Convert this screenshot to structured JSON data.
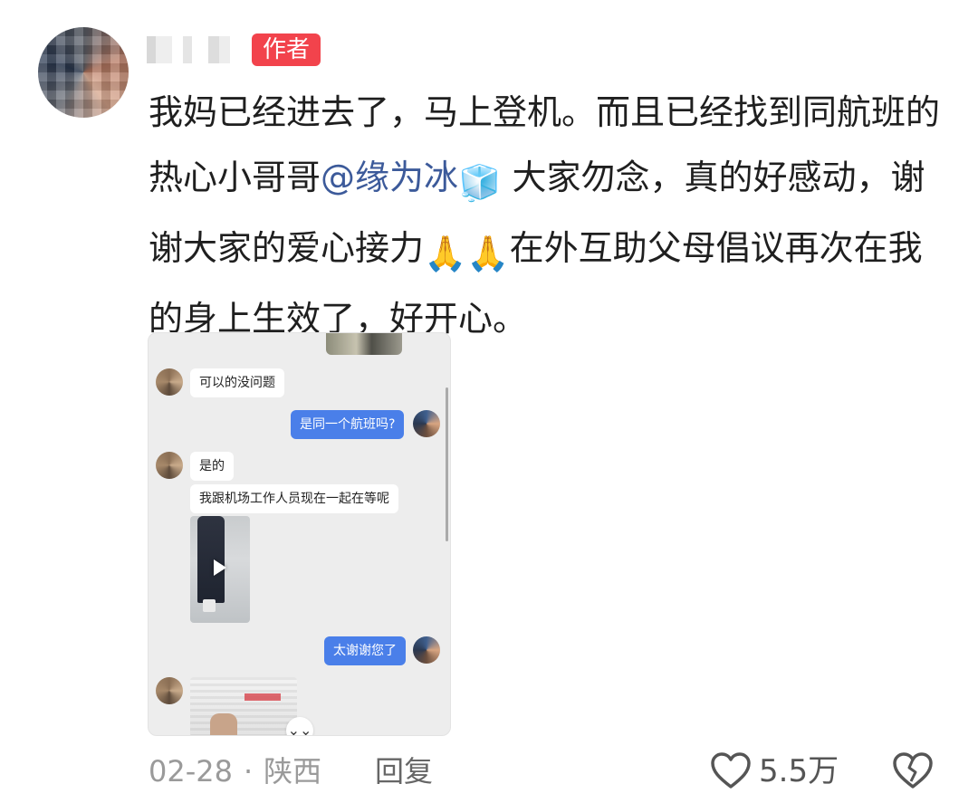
{
  "comment": {
    "username": "",
    "author_badge": "作者",
    "text_before_mention": "我妈已经进去了，马上登机。而且已经找到同航班的热心小哥哥",
    "mention": "@缘为冰",
    "mention_emoji": "🧊",
    "text_middle": " 大家勿念，真的好感动，谢谢大家的爱心接力",
    "pray_emoji_1": "🙏",
    "pray_emoji_2": "🙏",
    "text_after": "在外互助父母倡议再次在我的身上生效了，好开心。",
    "date": "02-28",
    "separator": "·",
    "location": "陕西",
    "reply_label": "回复",
    "like_count": "5.5万"
  },
  "chat_screenshot": {
    "messages": [
      {
        "side": "left",
        "text": "可以的没问题"
      },
      {
        "side": "right",
        "text": "是同一个航班吗?"
      },
      {
        "side": "left",
        "text": "是的"
      },
      {
        "side": "left",
        "text": "我跟机场工作人员现在一起在等呢"
      },
      {
        "side": "right",
        "text": "太谢谢您了"
      }
    ],
    "expand_icon": "⌄⌄"
  },
  "icons": {
    "like": "heart-outline-icon",
    "dislike": "broken-heart-icon"
  },
  "colors": {
    "author_badge_bg": "#f2434c",
    "mention": "#3c5a9a",
    "chat_blue_bubble": "#4a7fe9"
  }
}
